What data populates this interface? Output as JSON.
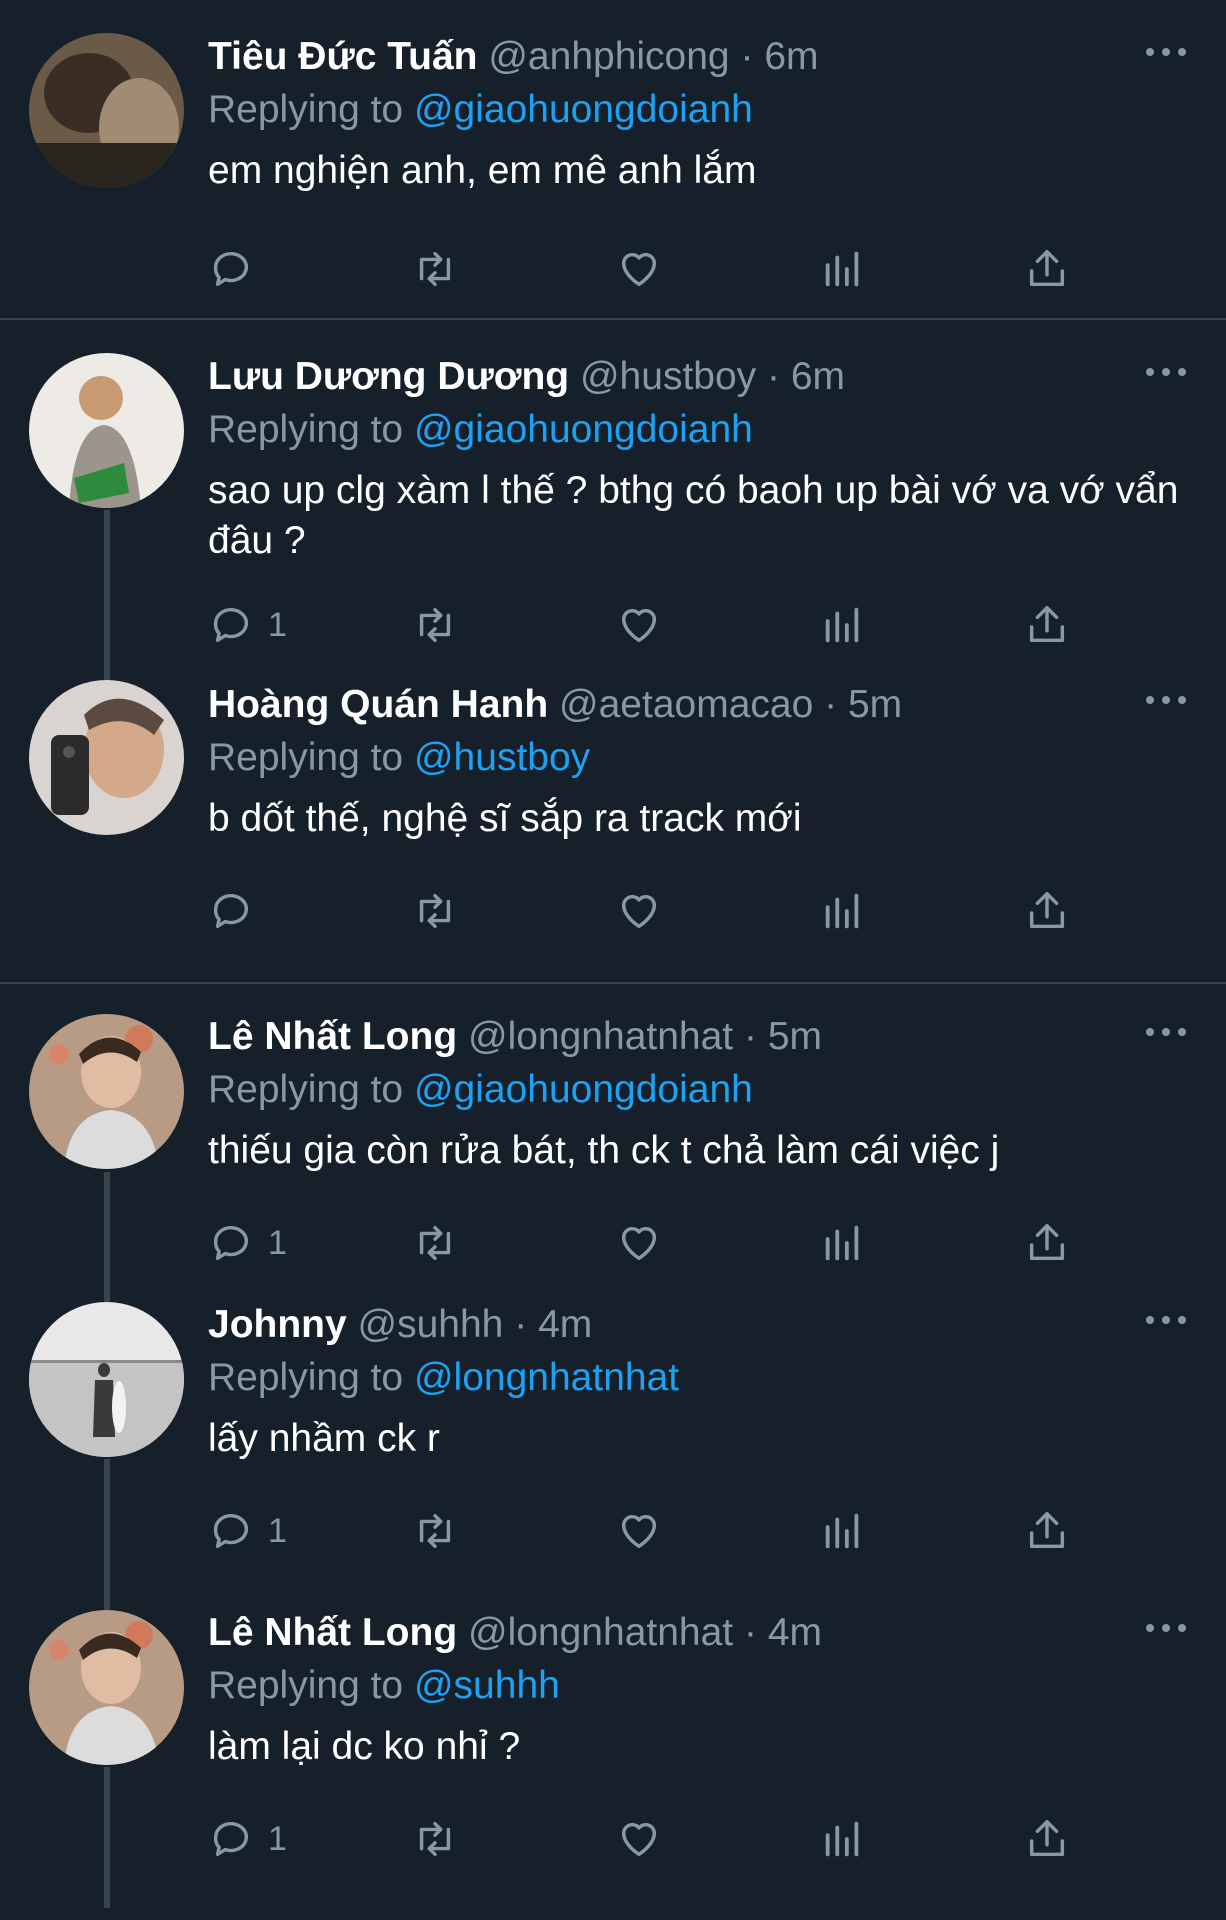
{
  "tweets": [
    {
      "name": "Tiêu Đức Tuấn",
      "handle": "@anhphicong",
      "dot": "·",
      "time": "6m",
      "replying": "Replying to",
      "mention": "@giaohuongdoianh",
      "text": "em nghiện anh, em mê anh lắm",
      "reply_count": ""
    },
    {
      "name": "Lưu Dương Dương",
      "handle": "@hustboy",
      "dot": "·",
      "time": "6m",
      "replying": "Replying to",
      "mention": "@giaohuongdoianh",
      "text": "sao up clg xàm l thế ? bthg có baoh up bài vớ va vớ vẩn đâu ?",
      "reply_count": "1"
    },
    {
      "name": "Hoàng Quán Hanh",
      "handle": "@aetaomacao",
      "dot": "·",
      "time": "5m",
      "replying": "Replying to",
      "mention": "@hustboy",
      "text": "b dốt thế, nghệ sĩ sắp ra track mới",
      "reply_count": ""
    },
    {
      "name": "Lê Nhất Long",
      "handle": "@longnhatnhat",
      "dot": "·",
      "time": "5m",
      "replying": "Replying to",
      "mention": "@giaohuongdoianh",
      "text": "thiếu gia còn rửa bát, th ck t chả làm cái việc j",
      "reply_count": "1"
    },
    {
      "name": "Johnny",
      "handle": "@suhhh",
      "dot": "·",
      "time": "4m",
      "replying": "Replying to",
      "mention": "@longnhatnhat",
      "text": "lấy nhầm ck r",
      "reply_count": "1"
    },
    {
      "name": "Lê Nhất Long",
      "handle": "@longnhatnhat",
      "dot": "·",
      "time": "4m",
      "replying": "Replying to",
      "mention": "@suhhh",
      "text": "làm lại dc ko nhỉ ?",
      "reply_count": "1"
    }
  ],
  "colors": {
    "background": "#15202b",
    "secondary": "#8899a6",
    "link": "#1da1f2",
    "divider": "#38444d"
  },
  "icons": [
    "reply-icon",
    "retweet-icon",
    "like-icon",
    "analytics-icon",
    "share-icon",
    "more-icon"
  ]
}
